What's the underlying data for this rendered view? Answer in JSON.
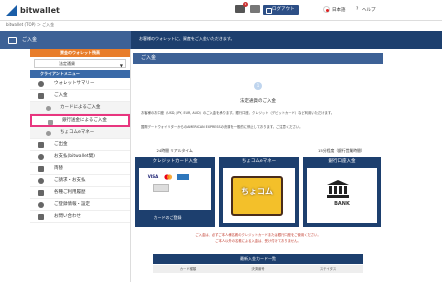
{
  "header": {
    "brand": "bitwallet",
    "login": "ログアウト",
    "mail_badge": "1",
    "lang": "日本語",
    "help_icon": "?",
    "help": "ヘルプ"
  },
  "breadcrumb": "bitwallet (TOP) ＞ ご入金",
  "title_bar": {
    "section": "ご入金",
    "message": "お客様のウォレットに、資産をご入金いただきます。"
  },
  "sidebar": {
    "wallet_select_title": "資金のウォレット残高",
    "wallet_select_value": "法定通貨",
    "menu_title": "クライアントメニュー",
    "items": [
      {
        "label": "ウォレットサマリー",
        "icon": "wallet-icon"
      },
      {
        "label": "ご入金",
        "icon": "deposit-icon"
      },
      {
        "label": "カードによるご入金",
        "icon": "card-icon",
        "sub": true
      },
      {
        "label": "銀行送金によるご入金",
        "icon": "bank-icon",
        "sub": true,
        "highlight": true
      },
      {
        "label": "ちょコムeマネー",
        "icon": "chocom-icon",
        "sub": true
      },
      {
        "label": "ご出金",
        "icon": "withdraw-icon"
      },
      {
        "label": "お支払(bitwallet間)",
        "icon": "transfer-icon"
      },
      {
        "label": "両替",
        "icon": "exchange-icon"
      },
      {
        "label": "ご請求・お支払",
        "icon": "invoice-icon"
      },
      {
        "label": "各種ご利用履歴",
        "icon": "history-icon"
      },
      {
        "label": "ご登録情報・設定",
        "icon": "settings-icon"
      },
      {
        "label": "お問い合わせ",
        "icon": "contact-icon"
      }
    ]
  },
  "main": {
    "heading": "ご入金",
    "step": "1",
    "title": "法定通貨のご入金",
    "desc1": "お客様のお口座（USD, JPY, EUR, AUD）のご入金を承ります。銀行口座、クレジット（デビットカード）など利用いただけます。",
    "desc2": "国際デートウォイリターからのAMERICAN EXPRESSの決済を一般的に停止しております。ご注意ください。",
    "tabs": [
      "24時間 リアルタイム",
      "",
      "15分程度（銀行営業時間）"
    ],
    "cards": [
      {
        "label": "クレジットカード入金",
        "signup": "カードのご登録"
      },
      {
        "label": "ちょコムeマネー",
        "logo_text": "ちょコム"
      },
      {
        "label": "銀行口座入金",
        "bank_text": "BANK"
      }
    ],
    "notice1": "ご入金は、必ずご本人様名義のクレジットカードまたは銀行口座をご使用ください。",
    "notice2": "ご本人以外の名義による入金は、受け付けておりません。",
    "history_title": "最新入金カード一覧",
    "history_cols": [
      "カード種類",
      "決済番号",
      "ステイタス"
    ]
  },
  "colors": {
    "navy": "#1d3f6e",
    "accent": "#3d6196",
    "orange": "#e87d2a",
    "highlight": "#e8367f"
  }
}
